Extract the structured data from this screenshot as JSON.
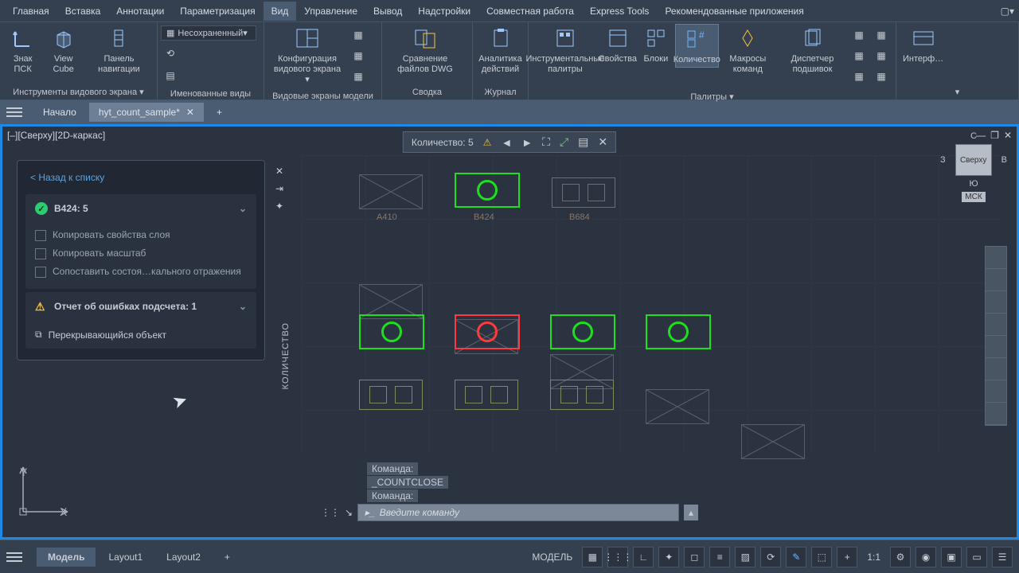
{
  "menu": {
    "items": [
      "Главная",
      "Вставка",
      "Аннотации",
      "Параметризация",
      "Вид",
      "Управление",
      "Вывод",
      "Надстройки",
      "Совместная работа",
      "Express Tools",
      "Рекомендованные приложения"
    ],
    "active": 4
  },
  "ribbon": {
    "g1": {
      "ucs": "Знак ПСК",
      "viewcube": "View Cube",
      "nav": "Панель навигации",
      "label": "Инструменты видового экрана ▾"
    },
    "g2": {
      "combo": "Несохраненный▾",
      "label": "Именованные виды"
    },
    "g3": {
      "config": "Конфигурация видового экрана ▾",
      "label": "Видовые экраны модели"
    },
    "g4": {
      "compare": "Сравнение файлов DWG",
      "label": "Сводка"
    },
    "g5": {
      "analytics": "Аналитика действий",
      "label": "Журнал"
    },
    "g6": {
      "tools": "Инструментальные палитры",
      "props": "Свойства",
      "blocks": "Блоки",
      "count": "Количество",
      "macros": "Макросы команд",
      "sheets": "Диспетчер подшивок",
      "label": "Палитры ▾"
    },
    "g7": {
      "iface": "Интерф…"
    }
  },
  "tabs": {
    "home": "Начало",
    "file": "hyt_count_sample*"
  },
  "viewlabel": "[–][Сверху][2D-каркас]",
  "count_toolbar": {
    "label": "Количество:",
    "value": "5"
  },
  "panel": {
    "back": "< Назад к списку",
    "h1": "B424: 5",
    "opt1": "Копировать свойства слоя",
    "opt2": "Копировать масштаб",
    "opt3": "Сопоставить состоя…кального отражения",
    "h2": "Отчет об ошибках подсчета: 1",
    "overlap": "Перекрывающийся объект"
  },
  "vtab": "КОЛИЧЕСТВО",
  "labels": {
    "a": "A410",
    "b": "B424",
    "c": "B684"
  },
  "viewcube": {
    "n": "С",
    "s": "Ю",
    "e": "В",
    "w": "З",
    "face": "Сверху",
    "msk": "МСК"
  },
  "cmd": {
    "l1": "Команда:",
    "l2": "_COUNTCLOSE",
    "l3": "Команда:",
    "ph": "Введите команду"
  },
  "layouts": {
    "model": "Модель",
    "l1": "Layout1",
    "l2": "Layout2"
  },
  "status": {
    "model": "МОДЕЛЬ",
    "scale": "1:1"
  },
  "ucs": {
    "x": "X",
    "y": "Y"
  }
}
